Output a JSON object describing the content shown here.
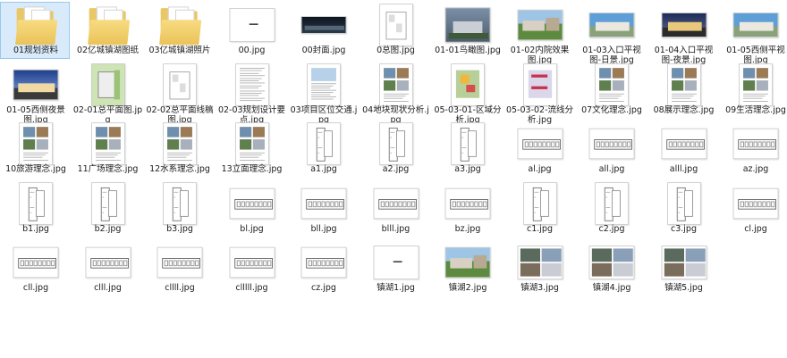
{
  "files": [
    {
      "name": "01规划资料",
      "kind": "folder",
      "selected": true
    },
    {
      "name": "02亿城镇湖图纸",
      "kind": "folder"
    },
    {
      "name": "03亿城镇湖照片",
      "kind": "folder"
    },
    {
      "name": "00.jpg",
      "kind": "page-title"
    },
    {
      "name": "00封面.jpg",
      "kind": "photo-dark"
    },
    {
      "name": "0总图.jpg",
      "kind": "plan"
    },
    {
      "name": "01-01鸟瞰图.jpg",
      "kind": "photo-aerial"
    },
    {
      "name": "01-02内院效果图.jpg",
      "kind": "photo-green"
    },
    {
      "name": "01-03入口平视图-日景.jpg",
      "kind": "photo-day"
    },
    {
      "name": "01-04入口平视图-夜景.jpg",
      "kind": "photo-night"
    },
    {
      "name": "01-05西侧平视图.jpg",
      "kind": "photo-day"
    },
    {
      "name": "01-05西侧夜景图.jpg",
      "kind": "photo-dusk"
    },
    {
      "name": "02-01总平面图.jpg",
      "kind": "plan-green"
    },
    {
      "name": "02-02总平面线稿图.jpg",
      "kind": "plan"
    },
    {
      "name": "02-03规划设计要点.jpg",
      "kind": "doc"
    },
    {
      "name": "03项目区位交通.jpg",
      "kind": "doc-map"
    },
    {
      "name": "04地块现状分析.jpg",
      "kind": "doc-photos"
    },
    {
      "name": "05-03-01-区域分析.jpg",
      "kind": "plan-color"
    },
    {
      "name": "05-03-02-流线分析.jpg",
      "kind": "plan-red"
    },
    {
      "name": "07文化理念.jpg",
      "kind": "doc-photos"
    },
    {
      "name": "08展示理念.jpg",
      "kind": "doc-photos"
    },
    {
      "name": "09生活理念.jpg",
      "kind": "doc-photos"
    },
    {
      "name": "10旅游理念.jpg",
      "kind": "doc-photos"
    },
    {
      "name": "11广场理念.jpg",
      "kind": "doc-photos"
    },
    {
      "name": "12水系理念.jpg",
      "kind": "doc-photos"
    },
    {
      "name": "13立面理念.jpg",
      "kind": "doc-photos"
    },
    {
      "name": "a1.jpg",
      "kind": "drawing"
    },
    {
      "name": "a2.jpg",
      "kind": "drawing"
    },
    {
      "name": "a3.jpg",
      "kind": "drawing"
    },
    {
      "name": "al.jpg",
      "kind": "elevation"
    },
    {
      "name": "all.jpg",
      "kind": "elevation"
    },
    {
      "name": "alll.jpg",
      "kind": "elevation"
    },
    {
      "name": "az.jpg",
      "kind": "elevation"
    },
    {
      "name": "b1.jpg",
      "kind": "drawing"
    },
    {
      "name": "b2.jpg",
      "kind": "drawing"
    },
    {
      "name": "b3.jpg",
      "kind": "drawing"
    },
    {
      "name": "bl.jpg",
      "kind": "elevation"
    },
    {
      "name": "bll.jpg",
      "kind": "elevation"
    },
    {
      "name": "blll.jpg",
      "kind": "elevation"
    },
    {
      "name": "bz.jpg",
      "kind": "elevation"
    },
    {
      "name": "c1.jpg",
      "kind": "drawing"
    },
    {
      "name": "c2.jpg",
      "kind": "drawing"
    },
    {
      "name": "c3.jpg",
      "kind": "drawing"
    },
    {
      "name": "cl.jpg",
      "kind": "elevation"
    },
    {
      "name": "cll.jpg",
      "kind": "elevation"
    },
    {
      "name": "clll.jpg",
      "kind": "elevation"
    },
    {
      "name": "cllll.jpg",
      "kind": "elevation"
    },
    {
      "name": "clllll.jpg",
      "kind": "elevation"
    },
    {
      "name": "cz.jpg",
      "kind": "elevation"
    },
    {
      "name": "镇湖1.jpg",
      "kind": "page-title"
    },
    {
      "name": "镇湖2.jpg",
      "kind": "photo-green"
    },
    {
      "name": "镇湖3.jpg",
      "kind": "photo-grid"
    },
    {
      "name": "镇湖4.jpg",
      "kind": "photo-grid"
    },
    {
      "name": "镇湖5.jpg",
      "kind": "photo-grid"
    }
  ]
}
